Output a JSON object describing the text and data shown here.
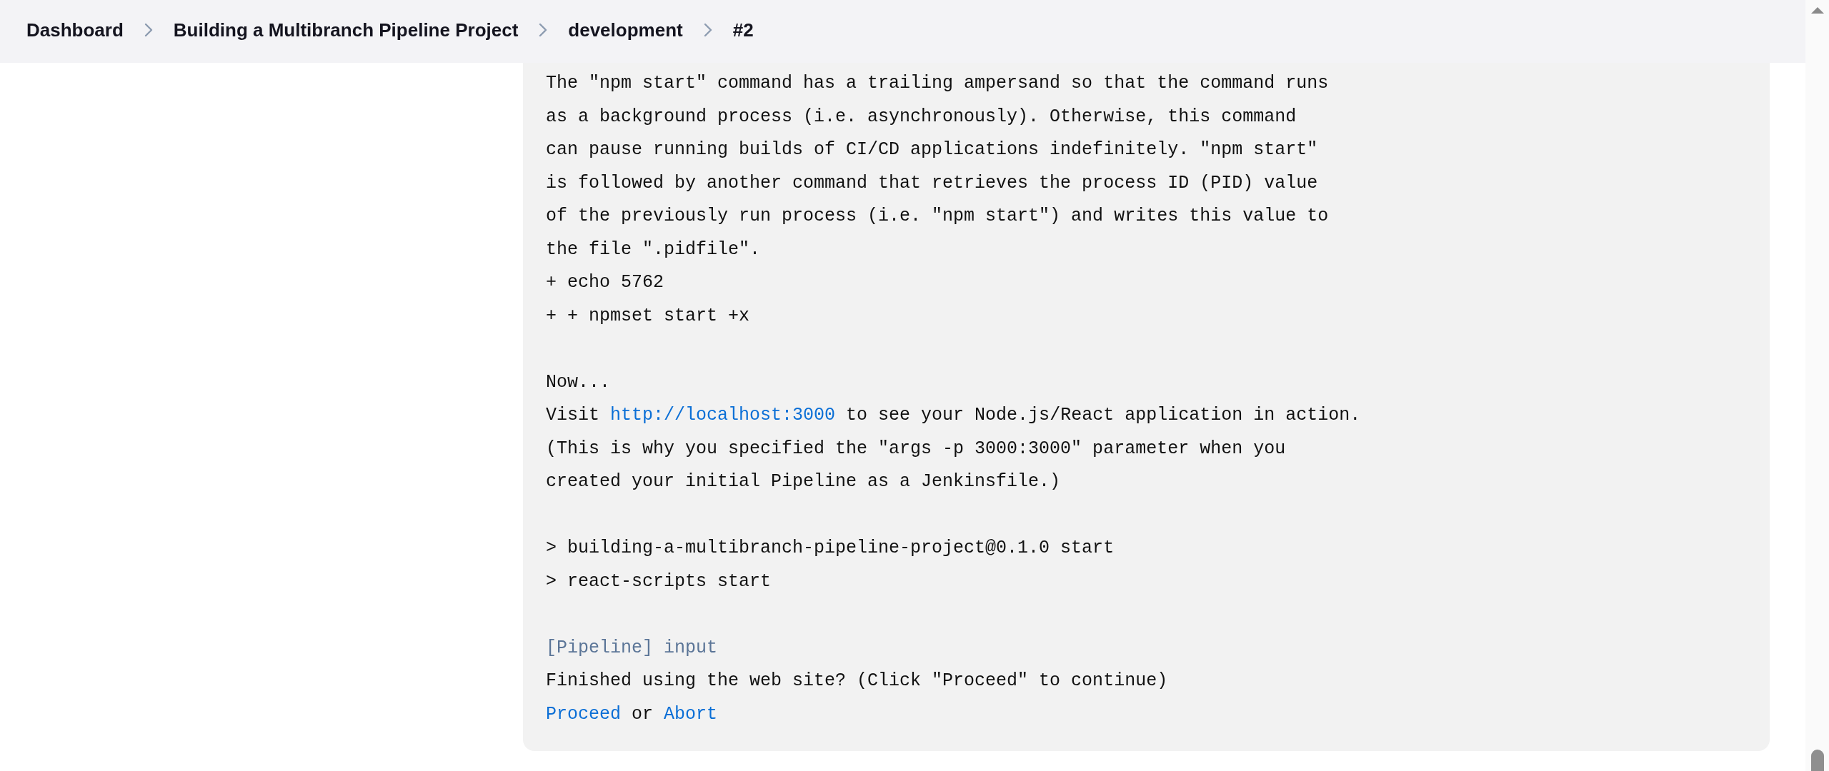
{
  "breadcrumbs": [
    {
      "label": "Dashboard"
    },
    {
      "label": "Building a Multibranch Pipeline Project"
    },
    {
      "label": "development"
    },
    {
      "label": "#2"
    }
  ],
  "console": {
    "lines": [
      {
        "kind": "text",
        "text": "The \"npm start\" command has a trailing ampersand so that the command runs"
      },
      {
        "kind": "text",
        "text": "as a background process (i.e. asynchronously). Otherwise, this command"
      },
      {
        "kind": "text",
        "text": "can pause running builds of CI/CD applications indefinitely. \"npm start\""
      },
      {
        "kind": "text",
        "text": "is followed by another command that retrieves the process ID (PID) value"
      },
      {
        "kind": "text",
        "text": "of the previously run process (i.e. \"npm start\") and writes this value to"
      },
      {
        "kind": "text",
        "text": "the file \".pidfile\"."
      },
      {
        "kind": "text",
        "text": "+ echo 5762"
      },
      {
        "kind": "text",
        "text": "+ + npmset start +x"
      },
      {
        "kind": "blank"
      },
      {
        "kind": "text",
        "text": "Now..."
      },
      {
        "kind": "mixed",
        "parts": [
          {
            "kind": "text",
            "text": "Visit "
          },
          {
            "kind": "link",
            "text": "http://localhost:3000"
          },
          {
            "kind": "text",
            "text": " to see your Node.js/React application in action."
          }
        ]
      },
      {
        "kind": "text",
        "text": "(This is why you specified the \"args -p 3000:3000\" parameter when you"
      },
      {
        "kind": "text",
        "text": "created your initial Pipeline as a Jenkinsfile.)"
      },
      {
        "kind": "blank"
      },
      {
        "kind": "text",
        "text": "> building-a-multibranch-pipeline-project@0.1.0 start"
      },
      {
        "kind": "text",
        "text": "> react-scripts start"
      },
      {
        "kind": "blank"
      },
      {
        "kind": "pipeline",
        "text": "[Pipeline] input"
      },
      {
        "kind": "text",
        "text": "Finished using the web site? (Click \"Proceed\" to continue)"
      },
      {
        "kind": "mixed",
        "parts": [
          {
            "kind": "link",
            "text": "Proceed"
          },
          {
            "kind": "text",
            "text": " or "
          },
          {
            "kind": "link",
            "text": "Abort"
          }
        ]
      }
    ]
  }
}
